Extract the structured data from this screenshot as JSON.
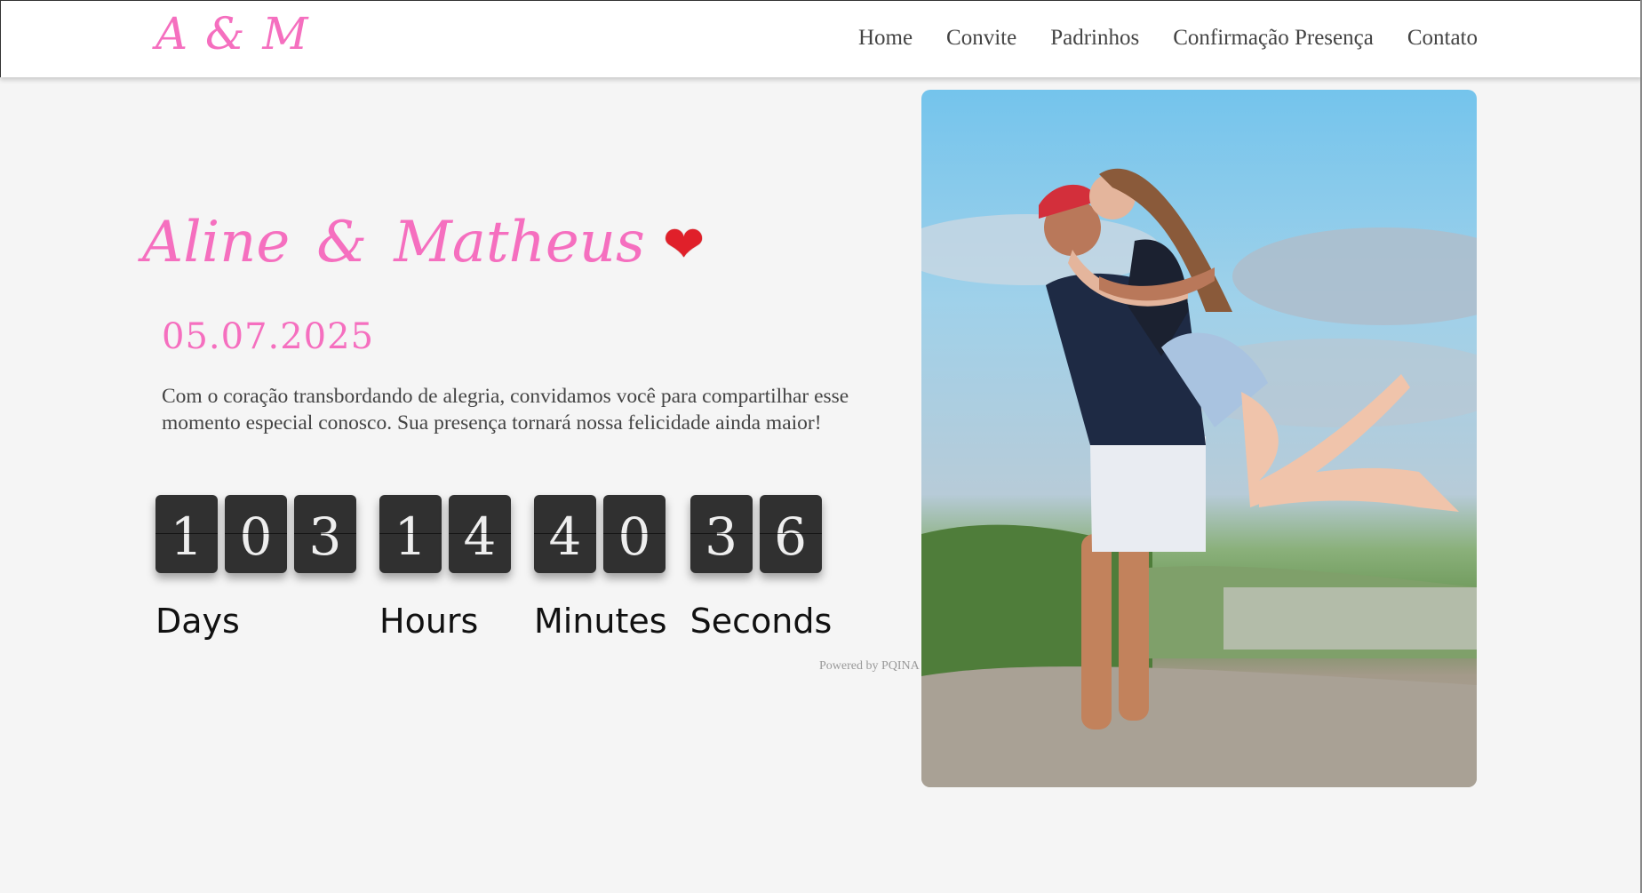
{
  "header": {
    "brand": "A & M",
    "nav": [
      "Home",
      "Convite",
      "Padrinhos",
      "Confirmação Presença",
      "Contato"
    ]
  },
  "hero": {
    "name_left": "Aline",
    "ampersand": "&",
    "name_right": "Matheus",
    "heart": "❤",
    "date": "05.07.2025",
    "intro": "Com o coração transbordando de alegria, convidamos você para compartilhar esse momento especial conosco. Sua presença tornará nossa felicidade ainda maior!"
  },
  "countdown": {
    "units": [
      {
        "label": "Days",
        "digits": [
          "1",
          "0",
          "3"
        ]
      },
      {
        "label": "Hours",
        "digits": [
          "1",
          "4"
        ]
      },
      {
        "label": "Minutes",
        "digits": [
          "4",
          "0"
        ]
      },
      {
        "label": "Seconds",
        "digits": [
          "3",
          "6"
        ]
      }
    ],
    "powered_by": "Powered by PQINA"
  },
  "colors": {
    "accent_pink": "#f56fbf",
    "digit_bg": "#303030",
    "heart_red": "#e0202a"
  }
}
